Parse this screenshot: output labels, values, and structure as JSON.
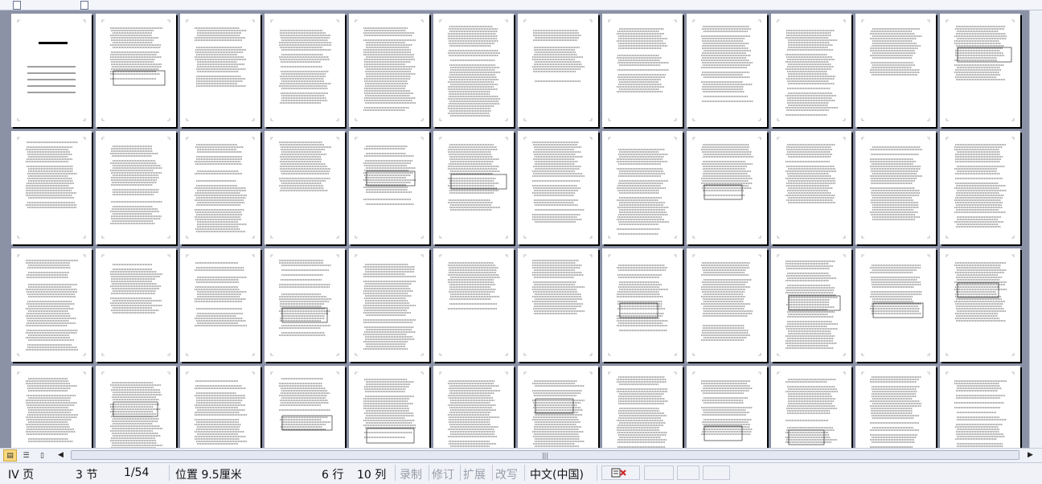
{
  "status_bar": {
    "page_label": "IV 页",
    "section_label": "3 节",
    "page_count": "1/54",
    "position_label": "位置 9.5厘米",
    "row_label": "6 行",
    "col_label": "10 列",
    "record_label": "录制",
    "revise_label": "修订",
    "extend_label": "扩展",
    "overwrite_label": "改写",
    "language_label": "中文(中国)",
    "spellcheck_icon": "book-check-icon"
  },
  "view_buttons": [
    {
      "name": "normal-view-button",
      "icon": "page-icon",
      "active": true
    },
    {
      "name": "outline-view-button",
      "icon": "list-icon",
      "active": false
    },
    {
      "name": "reading-view-button",
      "icon": "book-icon",
      "active": false
    }
  ],
  "thumbnails": {
    "rows": 4,
    "columns": 12,
    "total_pages": 54
  },
  "colors": {
    "canvas": "#8c92a6",
    "status_bar": "#f0f2f8",
    "active_view": "#f9d97e"
  }
}
